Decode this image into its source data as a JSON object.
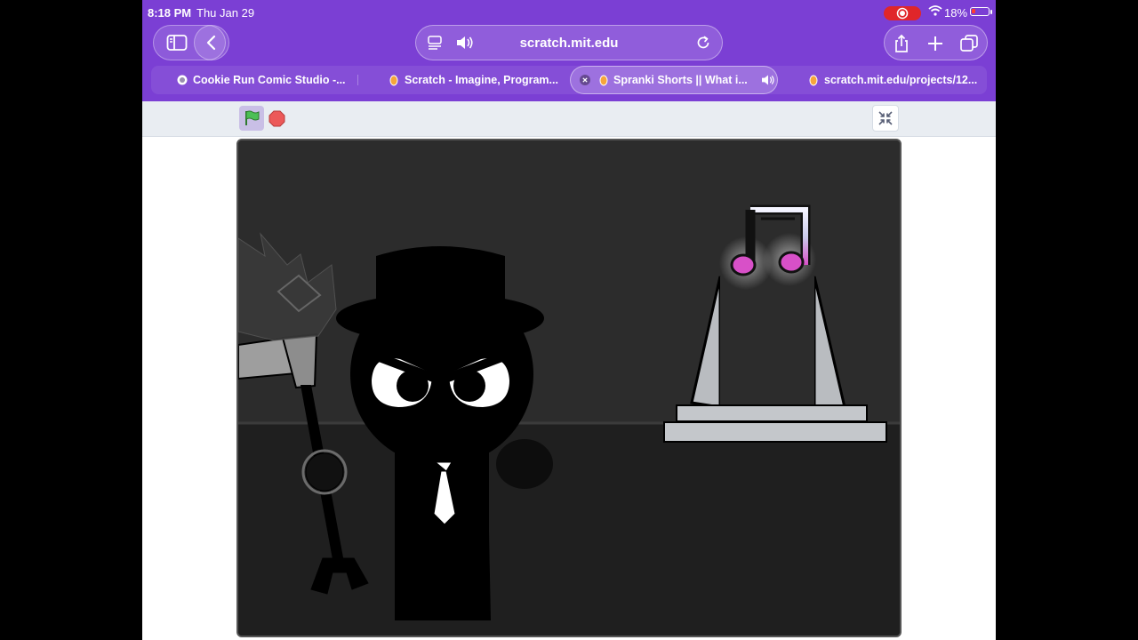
{
  "status_bar": {
    "time": "8:18 PM",
    "date": "Thu Jan 29",
    "battery": "18%"
  },
  "toolbar": {
    "sidebar_icon": "sidebar-icon",
    "back_icon": "chevron-left-icon",
    "url": "scratch.mit.edu",
    "reader_icon": "reader-icon",
    "audio_icon": "speaker-icon",
    "reload_icon": "reload-icon",
    "share_icon": "share-icon",
    "new_tab_icon": "plus-icon",
    "tabs_overview_icon": "tabs-icon"
  },
  "tabs": [
    {
      "label": "Cookie Run Comic Studio -..."
    },
    {
      "label": "Scratch - Imagine, Program..."
    },
    {
      "label": "Spranki Shorts || What i...",
      "active": true
    },
    {
      "label": "scratch.mit.edu/projects/12..."
    }
  ],
  "scratch": {
    "green_flag_icon": "green-flag-icon",
    "stop_icon": "stop-icon",
    "unfullscreen_icon": "unfullscreen-icon"
  },
  "colors": {
    "browser_chrome": "#7b3fd4",
    "stage_bg": "#2a2a2a",
    "note_pink": "#d850c8"
  }
}
